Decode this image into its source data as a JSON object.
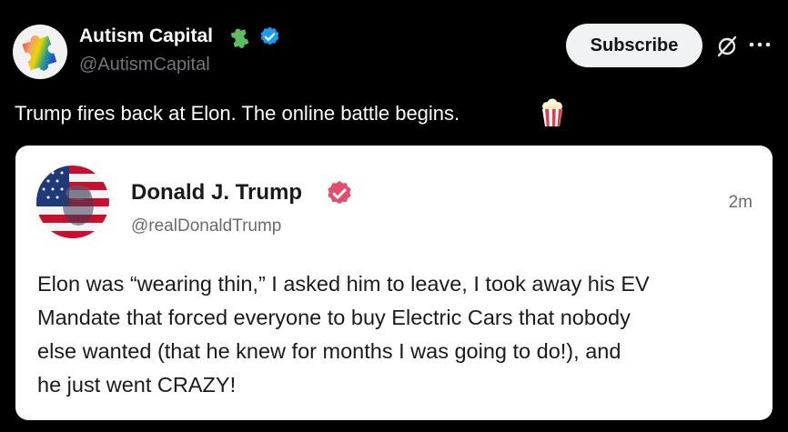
{
  "post": {
    "author_name": "Autism Capital",
    "author_handle": "@AutismCapital",
    "badges": [
      "puzzle-piece-icon",
      "verified-icon"
    ],
    "subscribe_label": "Subscribe",
    "text": "Trump fires back at Elon. The online battle begins.",
    "emoji": "popcorn-icon"
  },
  "quoted": {
    "author_name": "Donald J. Trump",
    "author_handle": "@realDonaldTrump",
    "time": "2m",
    "body_lines": [
      "Elon was “wearing thin,” I asked him to leave, I took away his EV",
      "Mandate that forced everyone to buy Electric Cars that nobody",
      "else wanted (that he knew for months I was going to do!), and",
      "he just went CRAZY!"
    ]
  },
  "colors": {
    "background": "#000000",
    "verified_blue": "#1d9bf0",
    "truth_badge_red": "#e34d6e",
    "subscribe_bg": "#eff3f4",
    "handle_gray": "#71767b",
    "puzzle_green": "#5dbb63"
  }
}
